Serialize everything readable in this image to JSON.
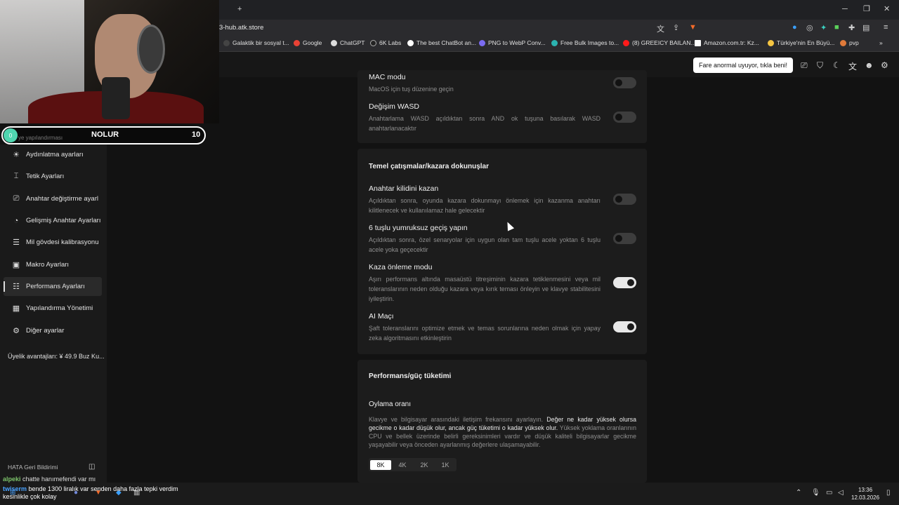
{
  "browser": {
    "address": "3-hub.atk.store",
    "new_tab_symbol": "+",
    "bookmarks": [
      "Galaktik bir sosyal t...",
      "Google",
      "ChatGPT",
      "6K Labs",
      "The best ChatBot an...",
      "PNG to WebP Conv...",
      "Free Bulk Images to...",
      "(8) GREEICY BAILAN...",
      "Amazon.com.tr: Kz...",
      "Türkiye'nin En Büyü...",
      "pvp"
    ],
    "bookmark_more": "»"
  },
  "header": {
    "notice_button": "Fare anormal uyuyor, tıkla beni!"
  },
  "overlay": {
    "circle": "0",
    "title": "NOLUR",
    "number": "10",
    "faded_text": "ye yapılandırması"
  },
  "sidebar": {
    "items": [
      {
        "label": "Aydınlatma ayarları",
        "icon": "☀"
      },
      {
        "label": "Tetik Ayarları",
        "icon": "⌶"
      },
      {
        "label": "Anahtar değiştirme ayarl",
        "icon": "⎚"
      },
      {
        "label": "Gelişmiş Anahtar Ayarları",
        "icon": "◔"
      },
      {
        "label": "Mil gövdesi kalibrasyonu",
        "icon": "☰"
      },
      {
        "label": "Makro Ayarları",
        "icon": "▣"
      },
      {
        "label": "Performans Ayarları",
        "icon": "☷"
      },
      {
        "label": "Yapılandırma Yönetimi",
        "icon": "▦"
      },
      {
        "label": "Diğer ayarlar",
        "icon": "⚙"
      }
    ],
    "membership": "Üyelik avantajları: ¥ 49.9 Buz Ku...",
    "feedback": "HATA Geri Bildirimi"
  },
  "chat": {
    "user1": "alpeki",
    "msg1": "chatte hanımefendi var mı",
    "user2": "twiserm",
    "msg2": "bende 1300 liralık var senden daha fazla tepki verdim kesinlikle çok kolay"
  },
  "settings": {
    "top_card": [
      {
        "title": "MAC modu",
        "desc": "MacOS için tuş düzenine geçin",
        "on": false
      },
      {
        "title": "Değişim WASD",
        "desc": "Anahtarlama WASD açıldıktan sonra AND ok tuşuna basılarak WASD anahtarlanacaktır",
        "on": false
      }
    ],
    "section1_title": "Temel çatışmalar/kazara dokunuşlar",
    "section1_items": [
      {
        "title": "Anahtar kilidini kazan",
        "desc": "Açıldıktan sonra, oyunda kazara dokunmayı önlemek için kazanma anahtarı kilitlenecek ve kullanılamaz hale gelecektir",
        "on": false
      },
      {
        "title": "6 tuşlu yumruksuz geçiş yapın",
        "desc": "Açıldıktan sonra, özel senaryolar için uygun olan tam tuşlu acele yoktan 6 tuşlu acele yoka geçecektir",
        "on": false
      },
      {
        "title": "Kaza önleme modu",
        "desc": "Aşırı performans altında masaüstü titreşiminin kazara tetiklenmesini veya mil toleranslarının neden olduğu kazara veya kırık teması önleyin ve klavye stabilitesini iyileştirin.",
        "on": true
      },
      {
        "title": "AI Maçı",
        "desc": "Şaft toleranslarını optimize etmek ve temas sorunlarına neden olmak için yapay zeka algoritmasını etkinleştirin",
        "on": true
      }
    ],
    "section2_title": "Performans/güç tüketimi",
    "polling": {
      "title": "Oylama oranı",
      "desc_a": "Klavye ve bilgisayar arasındaki iletişim frekansını ayarlayın.",
      "desc_b": "Değer ne kadar yüksek olursa gecikme o kadar düşük olur, ancak güç tüketimi o kadar yüksek olur.",
      "desc_c": "Yüksek yoklama oranlarının CPU ve bellek üzerinde belirli gereksinimleri vardır ve düşük kaliteli bilgisayarlar gecikme yaşayabilir veya önceden ayarlanmış değerlere ulaşamayabilir.",
      "options": [
        "8K",
        "4K",
        "2K",
        "1K"
      ],
      "selected": "8K"
    }
  },
  "taskbar": {
    "time": "13:36",
    "date": "12.03.2026"
  }
}
